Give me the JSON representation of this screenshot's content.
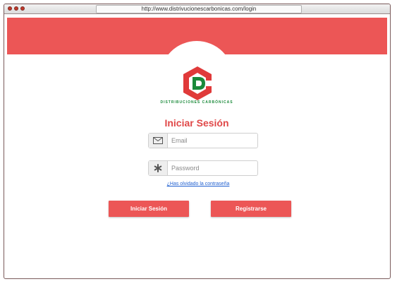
{
  "browser": {
    "url": "http://www.distrivucionescarbonicas.com/login"
  },
  "brand": {
    "name": "DISTRIBUCIONES CARBÓNICAS",
    "colors": {
      "red": "#e03a3a",
      "green": "#1a8a3a",
      "banner": "#ec5656"
    }
  },
  "login": {
    "title": "Iniciar Sesión",
    "email_placeholder": "Email",
    "email_icon": "envelope-icon",
    "password_placeholder": "Password",
    "password_icon": "asterisk-icon",
    "forgot_link": "¿Has olvidado la contraseña",
    "login_button": "Iniciar Sesión",
    "register_button": "Registrarse"
  }
}
